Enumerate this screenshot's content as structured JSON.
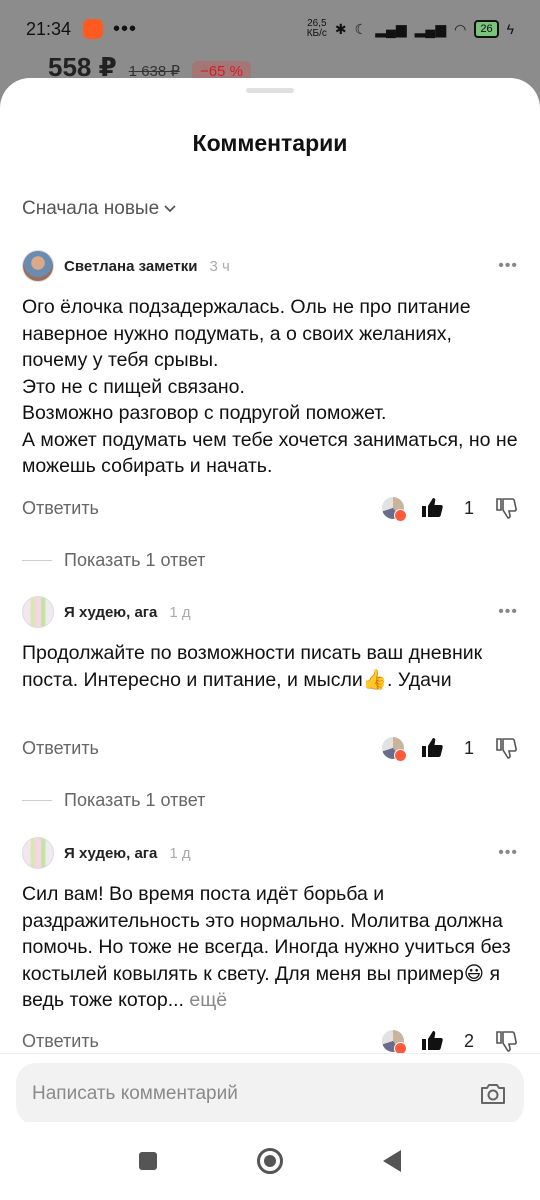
{
  "status_bar": {
    "time": "21:34",
    "net_speed": "26,5",
    "net_unit": "КБ/с",
    "battery": "26"
  },
  "product": {
    "price": "558 ₽",
    "old_price": "1 638 ₽",
    "discount": "−65 %"
  },
  "sheet": {
    "title": "Комментарии",
    "sort_label": "Сначала новые"
  },
  "comments": [
    {
      "author": "Светлана заметки",
      "ago": "3 ч",
      "text": "Ого ёлочка подзадержалась. Оль не про питание наверное нужно подумать, а о своих желаниях, почему у тебя срывы.\nЭто не с пищей связано.\nВозможно разговор с подругой поможет.\nА может подумать чем тебе хочется заниматься, но не можешь собирать и начать.",
      "reply_label": "Ответить",
      "likes": "1",
      "show_replies": "Показать 1 ответ"
    },
    {
      "author": "Я худею, ага",
      "ago": "1 д",
      "text": "Продолжайте по возможности писать ваш дневник поста. Интересно и питание, и мысли👍. Удачи",
      "reply_label": "Ответить",
      "likes": "1",
      "show_replies": "Показать 1 ответ"
    },
    {
      "author": "Я худею, ага",
      "ago": "1 д",
      "text": "Сил вам! Во время поста идёт борьба и раздражительность это нормально. Молитва должна помочь. Но тоже не всегда. Иногда нужно учиться без костылей ковылять к свету. Для меня вы пример😃 я ведь тоже котор...",
      "more_label": "ещё",
      "reply_label": "Ответить",
      "likes": "2"
    }
  ],
  "composer": {
    "placeholder": "Написать комментарий"
  }
}
